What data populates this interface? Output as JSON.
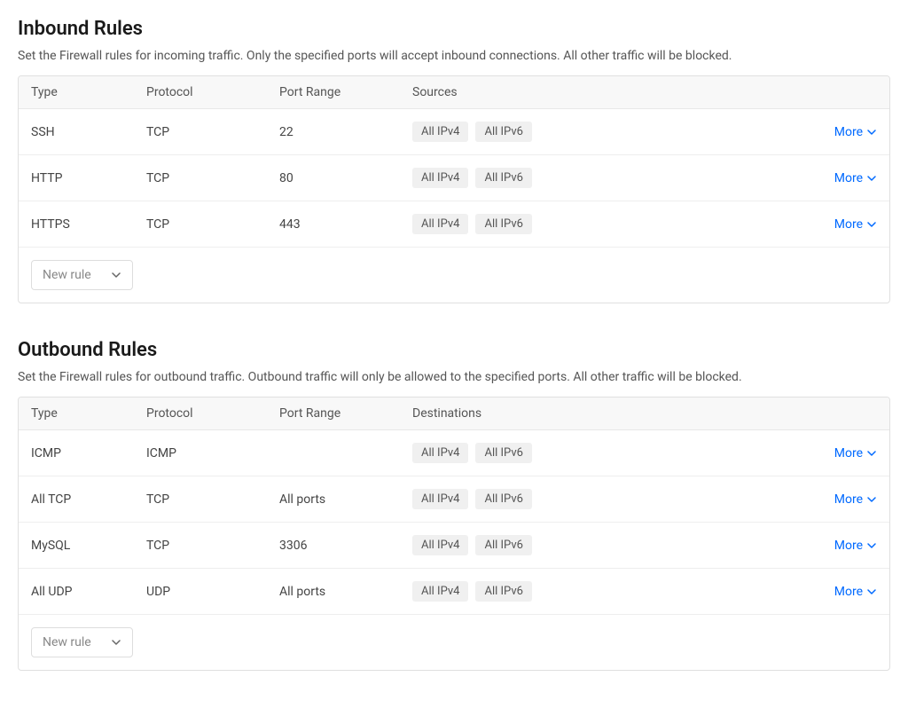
{
  "inbound": {
    "title": "Inbound Rules",
    "description": "Set the Firewall rules for incoming traffic. Only the specified ports will accept inbound connections. All other traffic will be blocked.",
    "columns": {
      "type": "Type",
      "protocol": "Protocol",
      "port": "Port Range",
      "sources": "Sources"
    },
    "rows": [
      {
        "type": "SSH",
        "protocol": "TCP",
        "port": "22",
        "tags": [
          "All IPv4",
          "All IPv6"
        ]
      },
      {
        "type": "HTTP",
        "protocol": "TCP",
        "port": "80",
        "tags": [
          "All IPv4",
          "All IPv6"
        ]
      },
      {
        "type": "HTTPS",
        "protocol": "TCP",
        "port": "443",
        "tags": [
          "All IPv4",
          "All IPv6"
        ]
      }
    ],
    "new_rule_label": "New rule",
    "more_label": "More"
  },
  "outbound": {
    "title": "Outbound Rules",
    "description": "Set the Firewall rules for outbound traffic. Outbound traffic will only be allowed to the specified ports. All other traffic will be blocked.",
    "columns": {
      "type": "Type",
      "protocol": "Protocol",
      "port": "Port Range",
      "sources": "Destinations"
    },
    "rows": [
      {
        "type": "ICMP",
        "protocol": "ICMP",
        "port": "",
        "tags": [
          "All IPv4",
          "All IPv6"
        ]
      },
      {
        "type": "All TCP",
        "protocol": "TCP",
        "port": "All ports",
        "tags": [
          "All IPv4",
          "All IPv6"
        ]
      },
      {
        "type": "MySQL",
        "protocol": "TCP",
        "port": "3306",
        "tags": [
          "All IPv4",
          "All IPv6"
        ]
      },
      {
        "type": "All UDP",
        "protocol": "UDP",
        "port": "All ports",
        "tags": [
          "All IPv4",
          "All IPv6"
        ]
      }
    ],
    "new_rule_label": "New rule",
    "more_label": "More"
  }
}
